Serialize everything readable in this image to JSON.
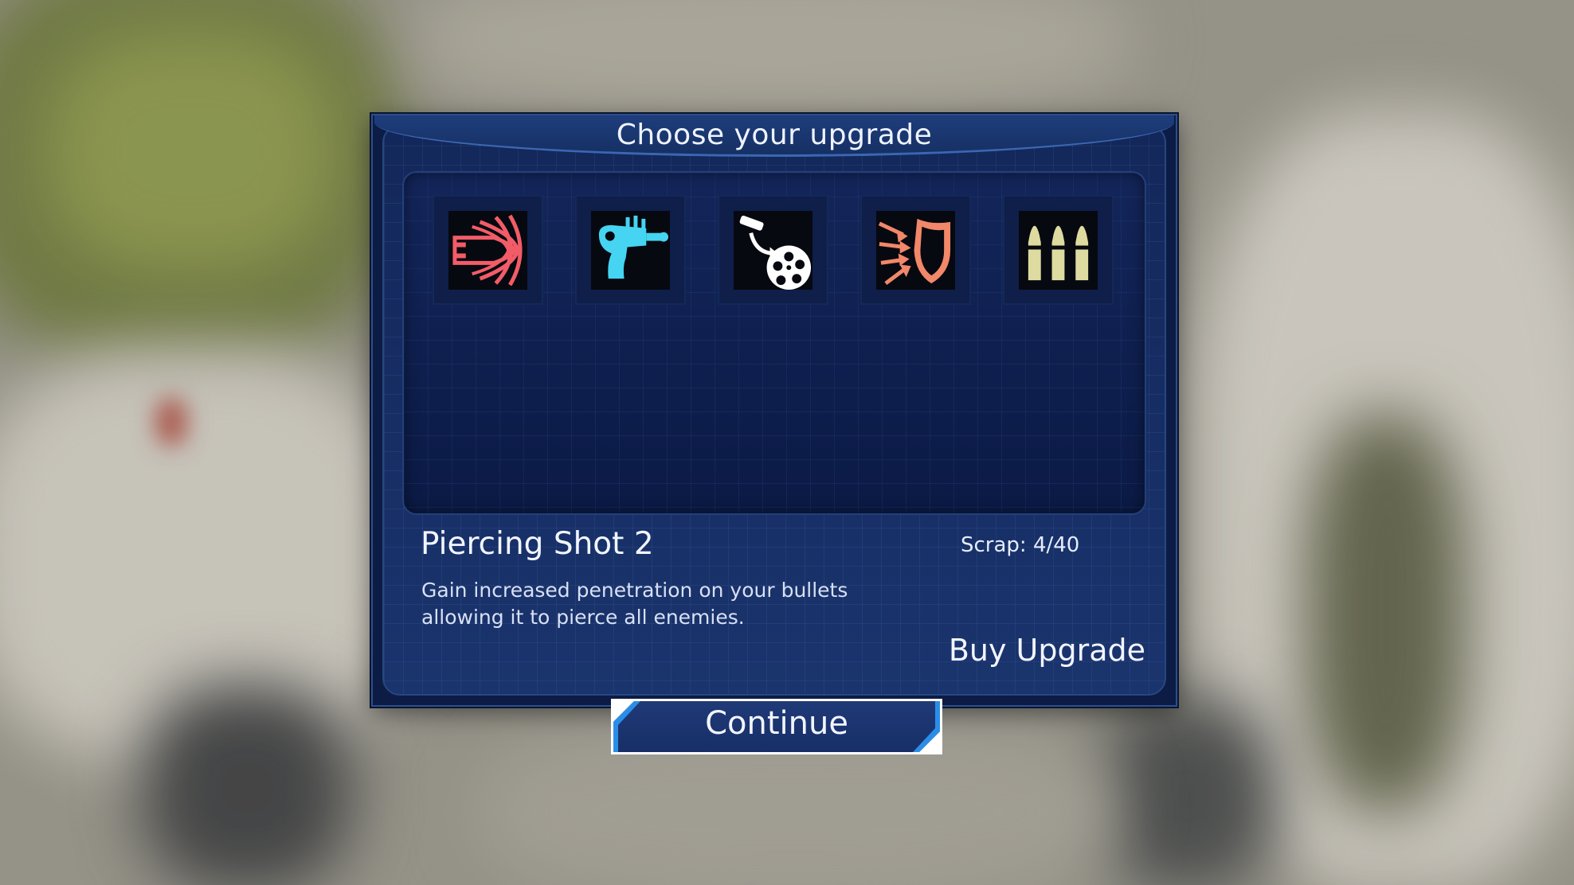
{
  "dialog": {
    "title": "Choose your upgrade"
  },
  "upgrades": [
    {
      "icon": "piercing-bullet-icon",
      "color": "#f25c68"
    },
    {
      "icon": "ray-gun-icon",
      "color": "#45d4f2"
    },
    {
      "icon": "ammo-reload-icon",
      "color": "#ffffff"
    },
    {
      "icon": "shield-deflect-icon",
      "color": "#f2876a"
    },
    {
      "icon": "triple-bullets-icon",
      "color": "#dedba0"
    }
  ],
  "selected": {
    "name": "Piercing Shot 2",
    "description": "Gain increased penetration on your bullets allowing it to pierce all enemies.",
    "scrap": "Scrap: 4/40"
  },
  "actions": {
    "buy_label": "Buy Upgrade",
    "continue_label": "Continue"
  },
  "colors": {
    "panel": "#142a5c",
    "accent": "#2a8ee8"
  }
}
